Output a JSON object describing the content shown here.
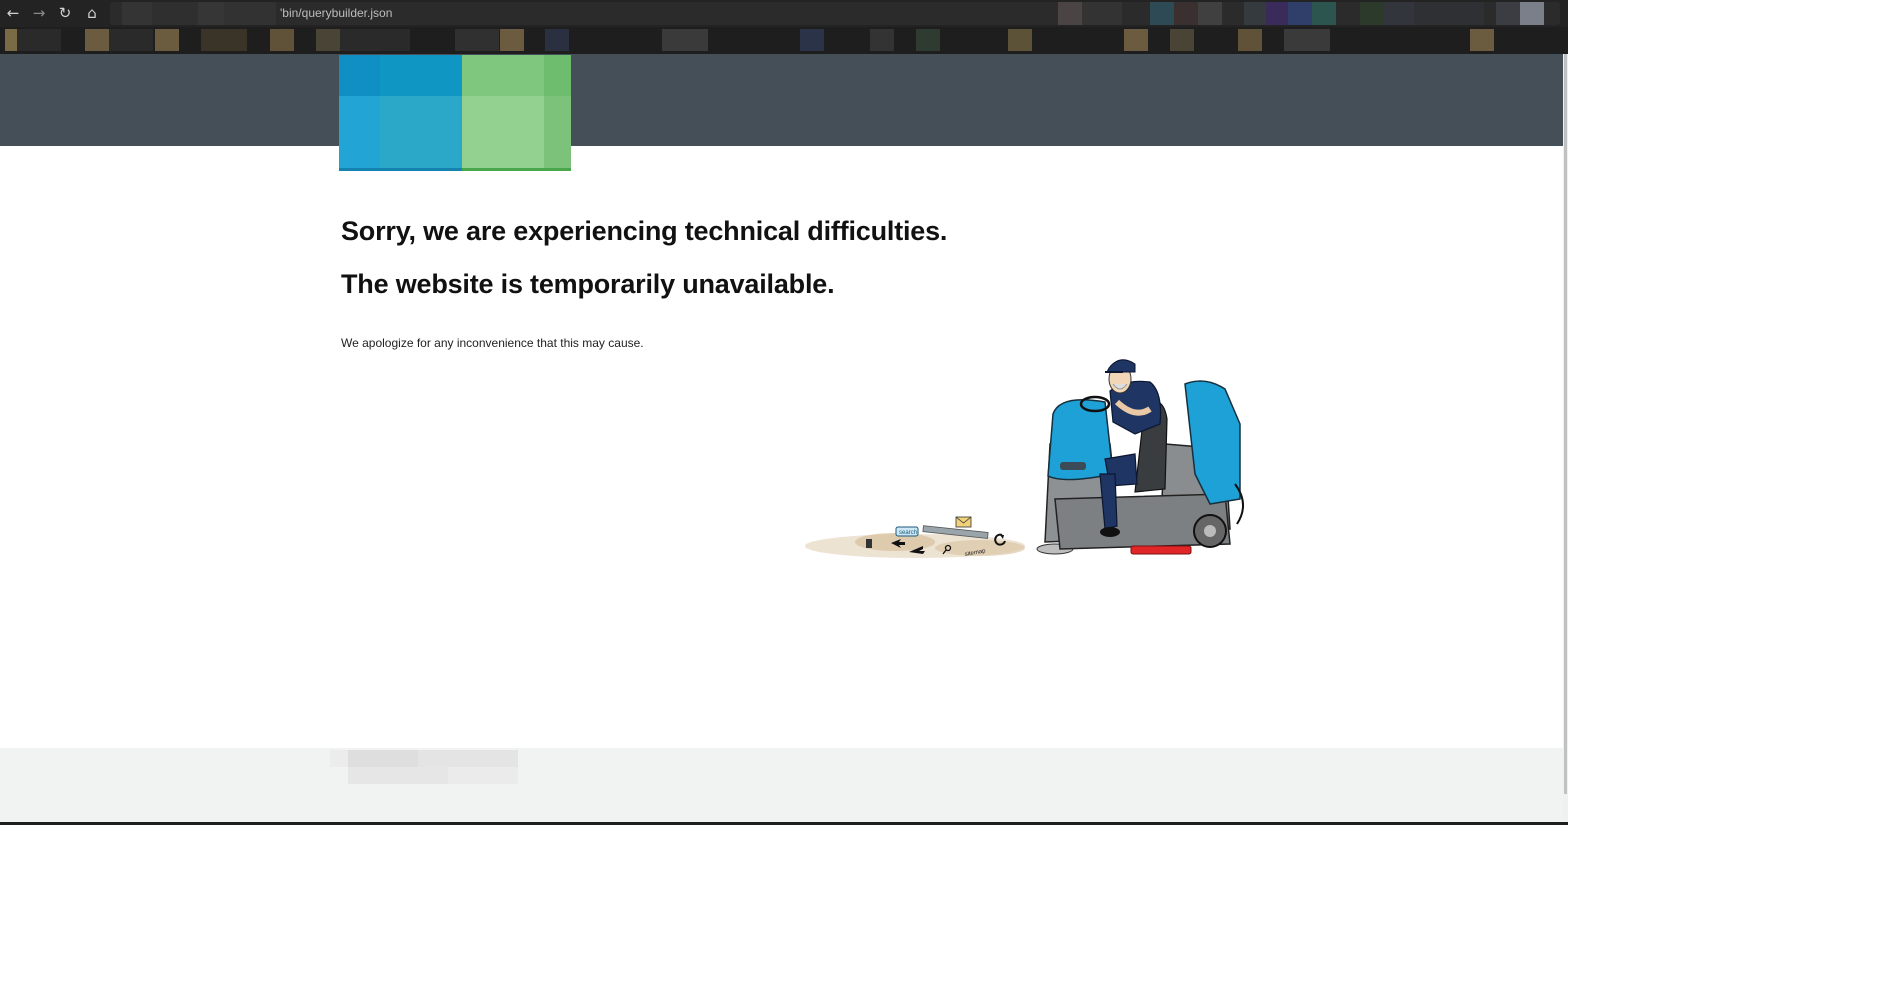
{
  "browser": {
    "back_icon": "←",
    "forward_icon": "→",
    "reload_icon": "↻",
    "home_icon": "⌂",
    "url": "'bin/querybuilder.json"
  },
  "page": {
    "headline_1": "Sorry, we are experiencing technical difficulties.",
    "headline_2": "The website is temporarily unavailable.",
    "apology": "We apologize for any inconvenience that this may cause."
  },
  "illustration": {
    "description_icon": "floor-scrubber-cleaning-debris-icon",
    "debris_labels": [
      "search",
      "sitemap"
    ]
  },
  "colors": {
    "header_bg": "#454f58",
    "logo_blue": "#1e9fd2",
    "logo_green": "#8ecf8c",
    "footer_bg": "#f1f2f2"
  }
}
